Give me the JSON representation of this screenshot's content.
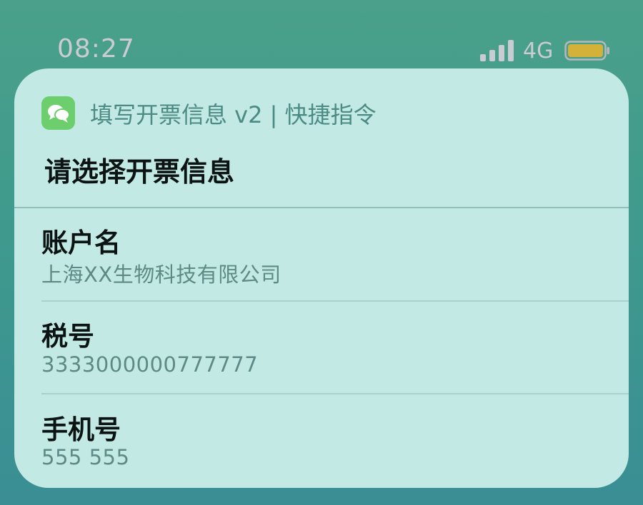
{
  "status_bar": {
    "time": "08:27",
    "network": "4G",
    "signal_icon": "signal-bars-icon",
    "battery_icon": "battery-icon",
    "battery_color": "#d4b23a"
  },
  "notification": {
    "app_icon": "messages-icon",
    "app_icon_color": "#6cce6c",
    "app_title": "填写开票信息 v2 | 快捷指令",
    "prompt": "请选择开票信息",
    "items": [
      {
        "label": "账户名",
        "value": "上海XX生物科技有限公司"
      },
      {
        "label": "税号",
        "value": "3333000000777777"
      },
      {
        "label": "手机号",
        "value": "555 555"
      }
    ]
  }
}
